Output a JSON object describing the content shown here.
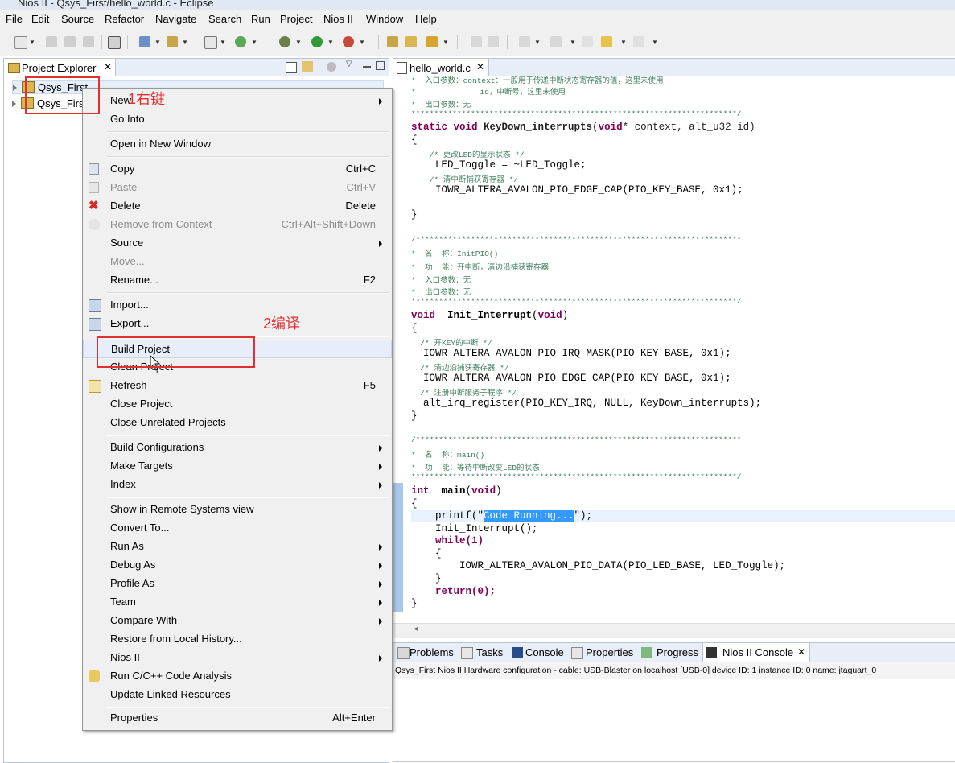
{
  "window": {
    "title": "Nios II - Qsys_First/hello_world.c - Eclipse"
  },
  "menubar": [
    "File",
    "Edit",
    "Source",
    "Refactor",
    "Navigate",
    "Search",
    "Run",
    "Project",
    "Nios II",
    "Window",
    "Help"
  ],
  "project_explorer": {
    "tab_label": "Project Explorer",
    "items": [
      "Qsys_First",
      "Qsys_Firs"
    ]
  },
  "editor": {
    "tab_label": "hello_world.c",
    "lines": [
      "*  入口参数：context：一般用于传递中断状态寄存器的值，这里未使用",
      "*              id，中断号，这里未使用",
      "*  出口参数：无",
      "***********************************************************************/",
      "static void KeyDown_interrupts(void* context, alt_u32 id)",
      "{",
      "    /* 更改LED的显示状态 */",
      "    LED_Toggle = ~LED_Toggle;",
      "    /* 清中断捕获寄存器 */",
      "    IOWR_ALTERA_AVALON_PIO_EDGE_CAP(PIO_KEY_BASE, 0x1);",
      "",
      "}",
      "",
      "/***********************************************************************",
      "*  名  称：InitPIO()",
      "*  功  能：开中断，清边沿捕获寄存器",
      "*  入口参数：无",
      "*  出口参数：无",
      "***********************************************************************/",
      "void  Init_Interrupt(void)",
      "{",
      "  /* 开KEY的中断 */",
      "  IOWR_ALTERA_AVALON_PIO_IRQ_MASK(PIO_KEY_BASE, 0x1);",
      "  /* 清边沿捕获寄存器 */",
      "  IOWR_ALTERA_AVALON_PIO_EDGE_CAP(PIO_KEY_BASE, 0x1);",
      "  /* 注册中断服务子程序 */",
      "  alt_irq_register(PIO_KEY_IRQ, NULL, KeyDown_interrupts);",
      "}",
      "",
      "/***********************************************************************",
      "*  名  称：main()",
      "*  功  能：等待中断改变LED的状态",
      "***********************************************************************/",
      "int  main(void)",
      "{",
      "    printf(\"",
      "Code Running...",
      "\");",
      "    Init_Interrupt();",
      "    while(1)",
      "    {",
      "        IOWR_ALTERA_AVALON_PIO_DATA(PIO_LED_BASE, LED_Toggle);",
      "    }",
      "    return(0);",
      "}"
    ]
  },
  "context_menu": {
    "items": [
      {
        "label": "New",
        "shortcut": "",
        "submenu": true,
        "disabled": false
      },
      {
        "label": "Go Into",
        "shortcut": "",
        "submenu": false,
        "disabled": false
      },
      {
        "label": "Open in New Window",
        "shortcut": "",
        "submenu": false,
        "disabled": false
      },
      {
        "label": "Copy",
        "shortcut": "Ctrl+C",
        "submenu": false,
        "disabled": false
      },
      {
        "label": "Paste",
        "shortcut": "Ctrl+V",
        "submenu": false,
        "disabled": true
      },
      {
        "label": "Delete",
        "shortcut": "Delete",
        "submenu": false,
        "disabled": false
      },
      {
        "label": "Remove from Context",
        "shortcut": "Ctrl+Alt+Shift+Down",
        "submenu": false,
        "disabled": true
      },
      {
        "label": "Source",
        "shortcut": "",
        "submenu": true,
        "disabled": false
      },
      {
        "label": "Move...",
        "shortcut": "",
        "submenu": false,
        "disabled": true
      },
      {
        "label": "Rename...",
        "shortcut": "F2",
        "submenu": false,
        "disabled": false
      },
      {
        "label": "Import...",
        "shortcut": "",
        "submenu": false,
        "disabled": false
      },
      {
        "label": "Export...",
        "shortcut": "",
        "submenu": false,
        "disabled": false
      },
      {
        "label": "Build Project",
        "shortcut": "",
        "submenu": false,
        "disabled": false
      },
      {
        "label": "Clean Project",
        "shortcut": "",
        "submenu": false,
        "disabled": false
      },
      {
        "label": "Refresh",
        "shortcut": "F5",
        "submenu": false,
        "disabled": false
      },
      {
        "label": "Close Project",
        "shortcut": "",
        "submenu": false,
        "disabled": false
      },
      {
        "label": "Close Unrelated Projects",
        "shortcut": "",
        "submenu": false,
        "disabled": false
      },
      {
        "label": "Build Configurations",
        "shortcut": "",
        "submenu": true,
        "disabled": false
      },
      {
        "label": "Make Targets",
        "shortcut": "",
        "submenu": true,
        "disabled": false
      },
      {
        "label": "Index",
        "shortcut": "",
        "submenu": true,
        "disabled": false
      },
      {
        "label": "Show in Remote Systems view",
        "shortcut": "",
        "submenu": false,
        "disabled": false
      },
      {
        "label": "Convert To...",
        "shortcut": "",
        "submenu": false,
        "disabled": false
      },
      {
        "label": "Run As",
        "shortcut": "",
        "submenu": true,
        "disabled": false
      },
      {
        "label": "Debug As",
        "shortcut": "",
        "submenu": true,
        "disabled": false
      },
      {
        "label": "Profile As",
        "shortcut": "",
        "submenu": true,
        "disabled": false
      },
      {
        "label": "Team",
        "shortcut": "",
        "submenu": true,
        "disabled": false
      },
      {
        "label": "Compare With",
        "shortcut": "",
        "submenu": true,
        "disabled": false
      },
      {
        "label": "Restore from Local History...",
        "shortcut": "",
        "submenu": false,
        "disabled": false
      },
      {
        "label": "Nios II",
        "shortcut": "",
        "submenu": true,
        "disabled": false
      },
      {
        "label": "Run C/C++ Code Analysis",
        "shortcut": "",
        "submenu": false,
        "disabled": false
      },
      {
        "label": "Update Linked Resources",
        "shortcut": "",
        "submenu": false,
        "disabled": false
      },
      {
        "label": "Properties",
        "shortcut": "Alt+Enter",
        "submenu": false,
        "disabled": false
      }
    ]
  },
  "bottom_panel": {
    "tabs": [
      "Problems",
      "Tasks",
      "Console",
      "Properties",
      "Progress",
      "Nios II Console"
    ],
    "status": "Qsys_First Nios II Hardware configuration - cable: USB-Blaster on localhost [USB-0] device ID: 1 instance ID: 0 name: jtaguart_0"
  },
  "annotations": {
    "step1": "1右键",
    "step2": "2编译"
  },
  "colors": {
    "accent_red": "#e03030",
    "selection": "#3399ff",
    "keyword": "#7f0055",
    "comment": "#3f7f5f"
  }
}
